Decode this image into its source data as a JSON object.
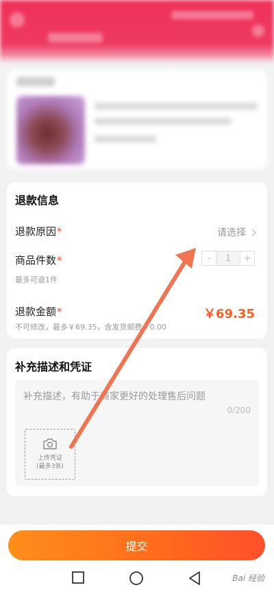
{
  "refund_info": {
    "title": "退款信息",
    "reason_label": "退款原因",
    "required_mark": "*",
    "reason_select_placeholder": "请选择",
    "quantity_label": "商品件数",
    "quantity_value": "1",
    "quantity_minus": "-",
    "quantity_plus": "+",
    "quantity_note": "最多可退1件",
    "amount_label": "退款金额",
    "amount_value": "￥69.35",
    "amount_note": "不可修改，最多￥69.35，含发货邮费￥0.00"
  },
  "description": {
    "title": "补充描述和凭证",
    "placeholder": "补充描述，有助于商家更好的处理售后问题",
    "char_count": "0/200",
    "upload_label": "上传凭证",
    "upload_limit": "(最多3张)"
  },
  "submit": {
    "label": "提交"
  },
  "watermark": "Bai 经验",
  "colors": {
    "header": "#f0305a",
    "accent_price": "#ff5a1f",
    "required": "#ff4a2e",
    "submit_gradient_start": "#ff8e19",
    "submit_gradient_end": "#ff4f2a",
    "annotation_arrow": "#f0744f"
  },
  "icons": {
    "chevron": "chevron-right-icon",
    "camera": "camera-icon",
    "nav_recents": "square-recents-icon",
    "nav_home": "circle-home-icon",
    "nav_back": "triangle-back-icon"
  }
}
